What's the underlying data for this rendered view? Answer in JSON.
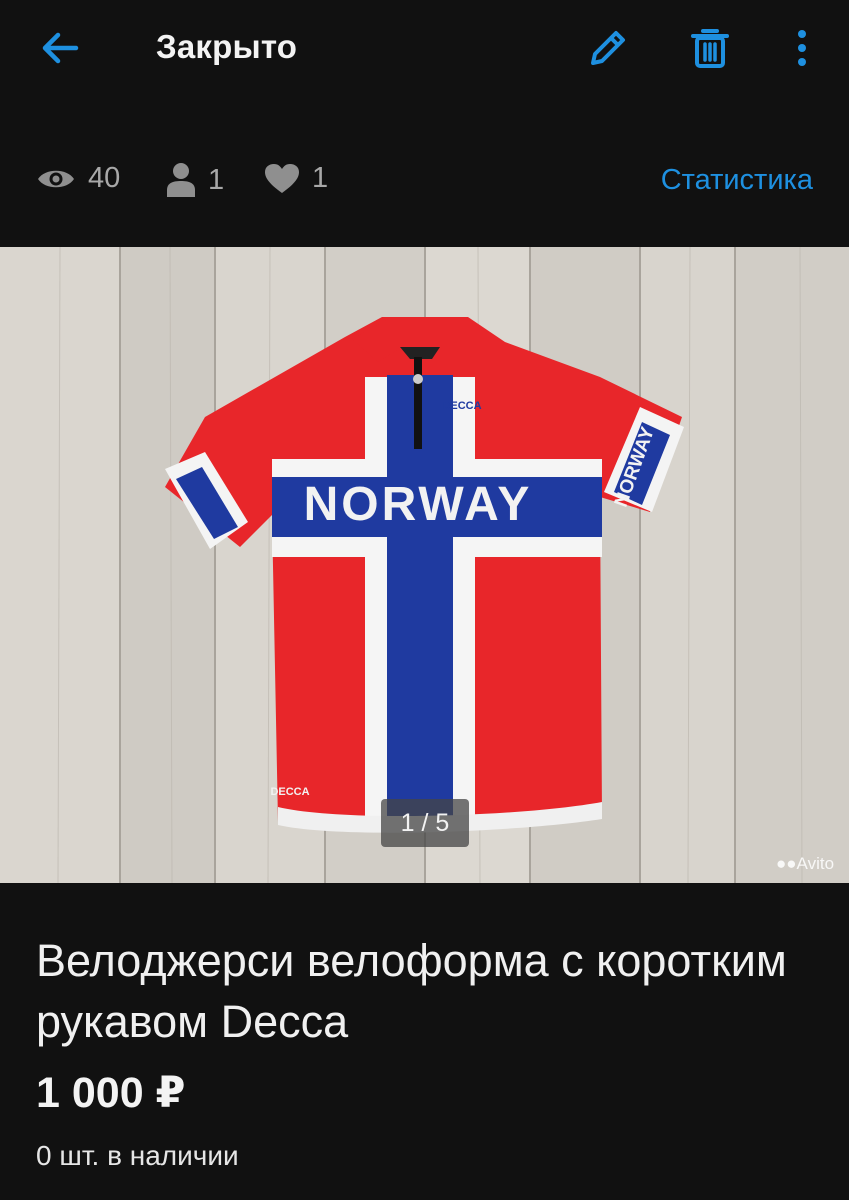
{
  "header": {
    "title": "Закрыто",
    "accent_color": "#1e90e0",
    "icons": [
      "arrow-left-icon",
      "pencil-icon",
      "trash-icon",
      "more-vertical-icon"
    ]
  },
  "stats": {
    "views": "40",
    "contacts": "1",
    "favorites": "1",
    "link_label": "Статистика"
  },
  "photo": {
    "jersey_text": "NORWAY",
    "sleeve_text": "NORWAY",
    "brand_text": "DECCA",
    "counter": "1 / 5",
    "watermark": "Avito"
  },
  "listing": {
    "title": "Велоджерси велоформа с коротким рукавом Decca",
    "price": "1 000 ₽",
    "stock": "0 шт. в наличии"
  }
}
